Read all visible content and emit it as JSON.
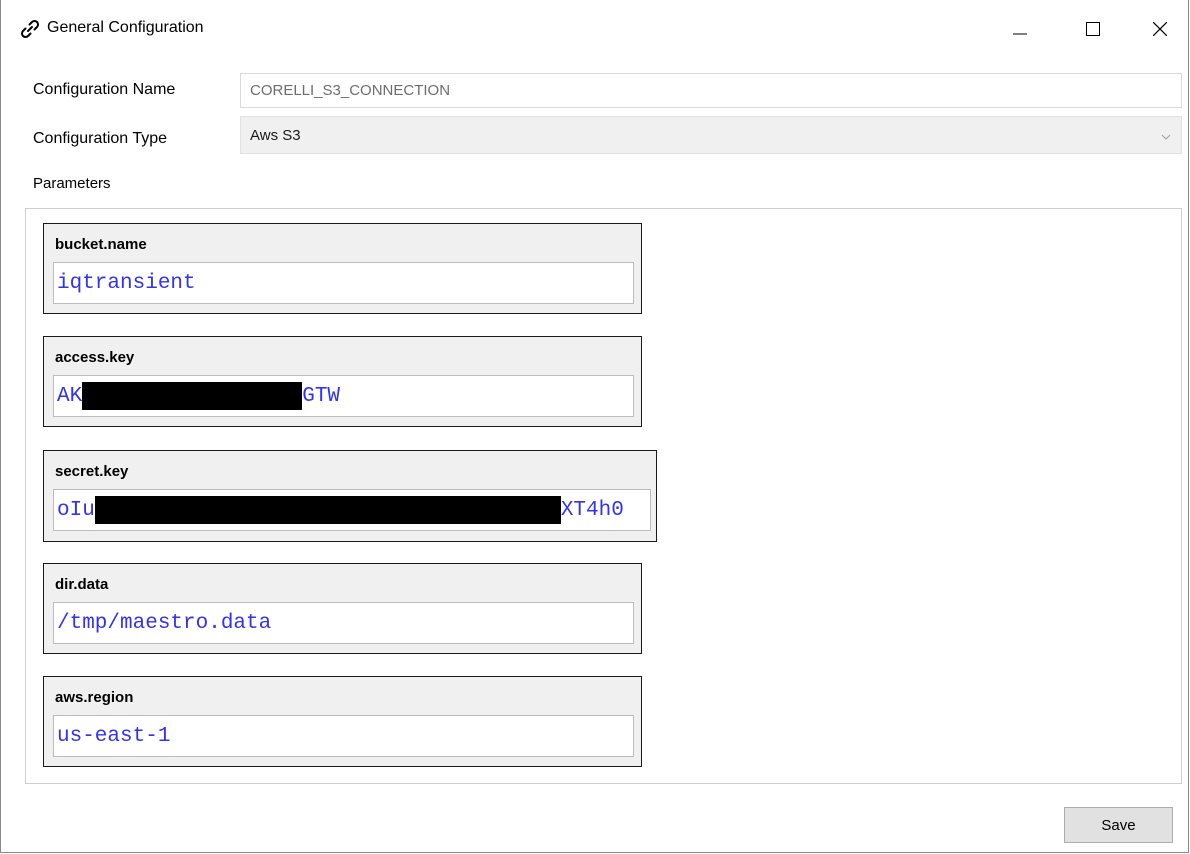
{
  "window": {
    "title": "General Configuration",
    "icon": "link-icon"
  },
  "form": {
    "name_label": "Configuration Name",
    "name_value": "CORELLI_S3_CONNECTION",
    "type_label": "Configuration Type",
    "type_value": "Aws S3",
    "parameters_label": "Parameters"
  },
  "parameters": [
    {
      "name": "bucket.name",
      "value": "iqtransient"
    },
    {
      "name": "access.key",
      "value_prefix": "AK",
      "value_suffix": "GTW",
      "redacted": true
    },
    {
      "name": "secret.key",
      "value_prefix": "oIu",
      "value_suffix": "XT4h0",
      "redacted": true
    },
    {
      "name": "dir.data",
      "value": "/tmp/maestro.data"
    },
    {
      "name": "aws.region",
      "value": "us-east-1"
    }
  ],
  "actions": {
    "save_label": "Save"
  },
  "colors": {
    "param_value": "#3333ee",
    "card_background": "#f0f0f0"
  }
}
